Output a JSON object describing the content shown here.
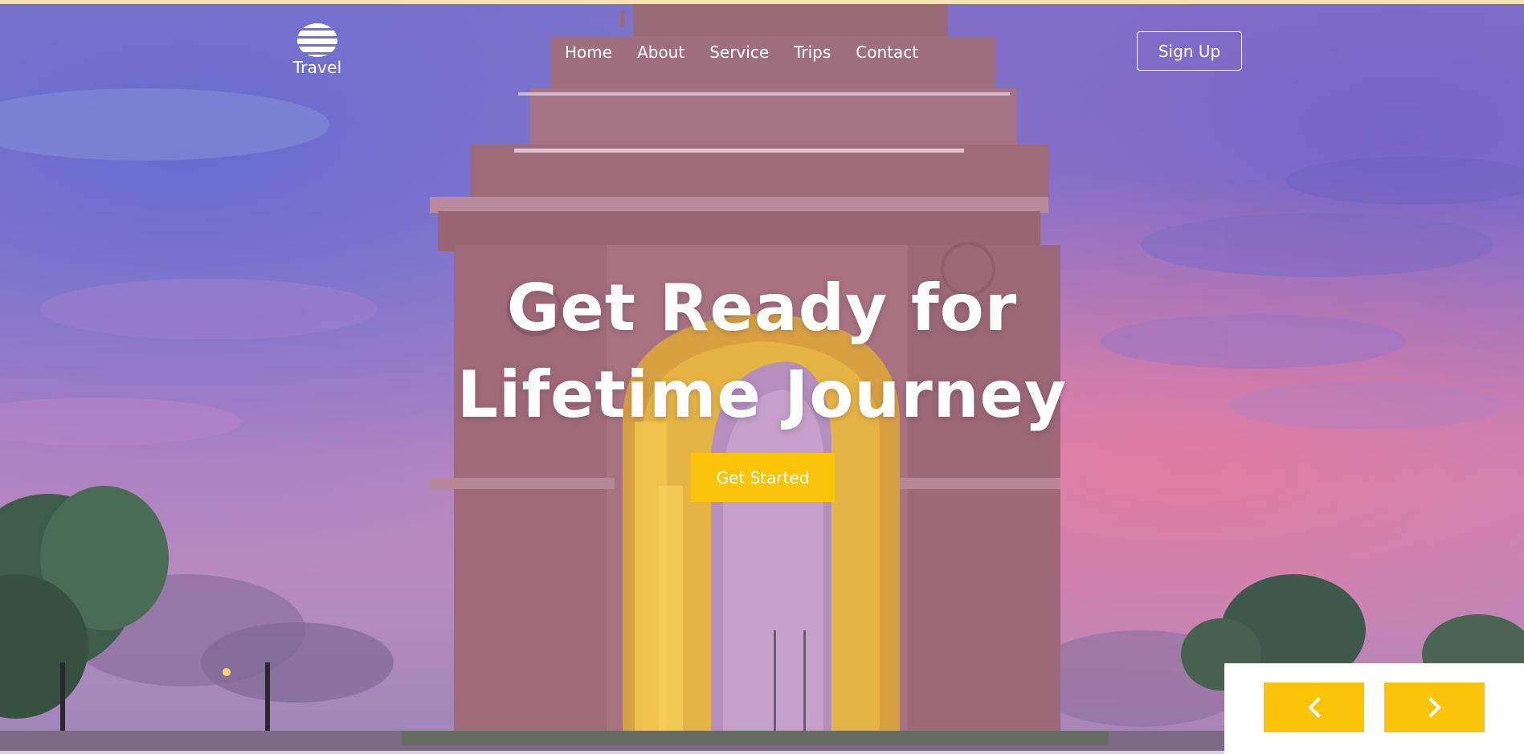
{
  "brand": {
    "name": "Travel",
    "icon": "globe-icon"
  },
  "nav": {
    "items": [
      {
        "label": "Home"
      },
      {
        "label": "About"
      },
      {
        "label": "Service"
      },
      {
        "label": "Trips"
      },
      {
        "label": "Contact"
      }
    ]
  },
  "header": {
    "signup_label": "Sign Up"
  },
  "hero": {
    "headline_line1": "Get Ready for",
    "headline_line2": "Lifetime Journey",
    "cta_label": "Get Started"
  },
  "slider": {
    "prev_icon": "chevron-left-icon",
    "next_icon": "chevron-right-icon"
  },
  "colors": {
    "accent": "#fcc409",
    "text_on_hero": "#ffffff",
    "top_strip": "#f7e2b8"
  }
}
